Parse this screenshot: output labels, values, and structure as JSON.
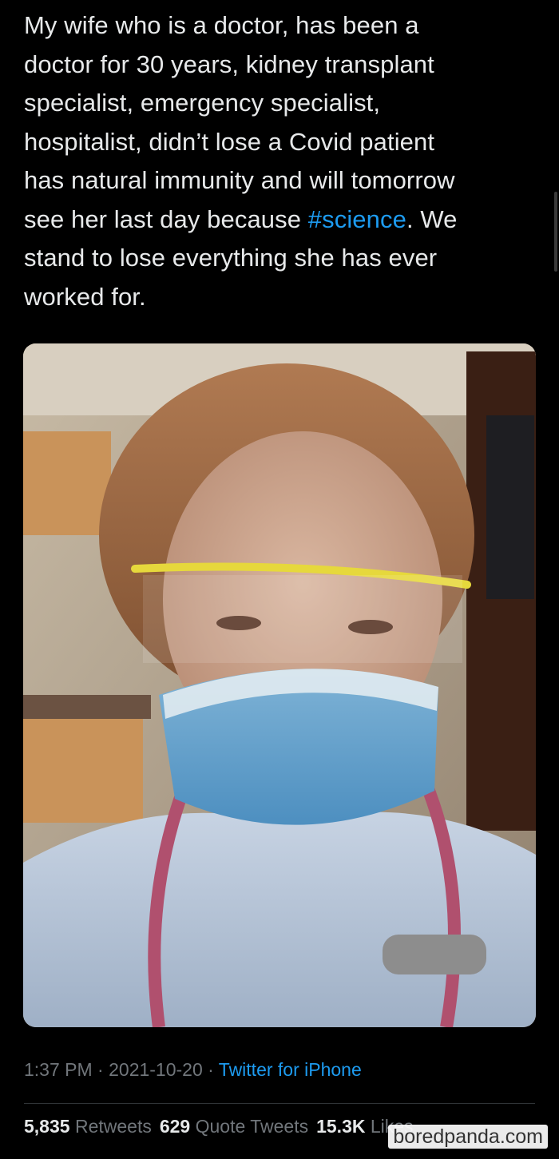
{
  "tweet": {
    "text_lines": [
      "My wife who is a doctor, has been a",
      "doctor for 30 years, kidney transplant",
      "specialist, emergency specialist,",
      "hospitalist, didn’t lose a Covid patient",
      "has natural immunity and will tomorrow"
    ],
    "line6_before": "see her last day because ",
    "hashtag": "#science",
    "line6_after": ". We",
    "line7": "stand to lose everything she has ever",
    "line8": "worked for."
  },
  "meta": {
    "time": "1:37 PM",
    "separator": " · ",
    "date": "2021-10-20",
    "source": "Twitter for iPhone"
  },
  "stats": {
    "retweets_count": "5,835",
    "retweets_label": "Retweets",
    "quotes_count": "629",
    "quotes_label": "Quote Tweets",
    "likes_count": "15.3K",
    "likes_label": "Likes"
  },
  "watermark": "boredpanda.com",
  "colors": {
    "background": "#000000",
    "text": "#e7e9ea",
    "muted": "#71767b",
    "accent": "#1d9bf0"
  }
}
